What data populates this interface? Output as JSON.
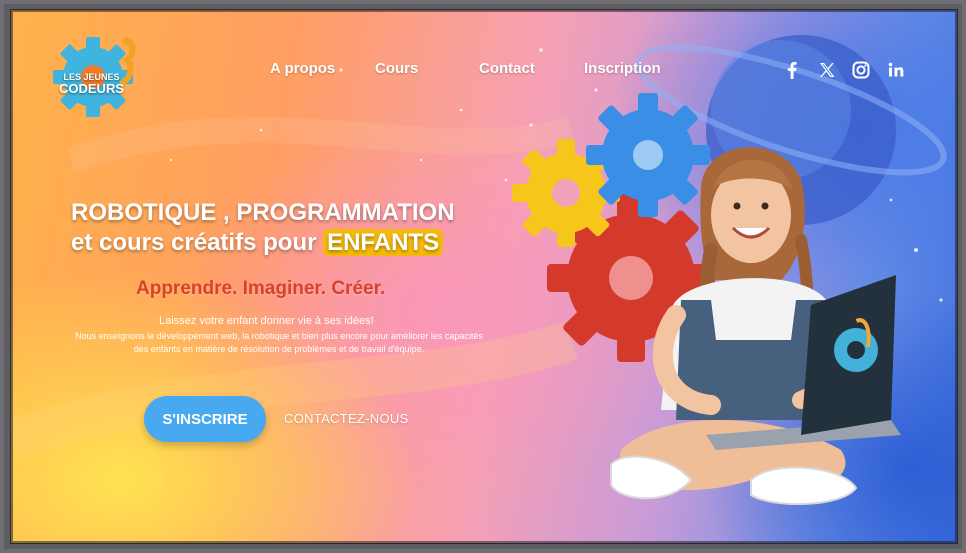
{
  "brand": {
    "line1": "LES JEUNES",
    "line2": "CODEURS"
  },
  "nav": {
    "items": [
      "A propos",
      "Cours",
      "Contact",
      "Inscription"
    ]
  },
  "social": [
    "facebook-icon",
    "x-icon",
    "instagram-icon",
    "linkedin-icon"
  ],
  "hero": {
    "headline_line1": "ROBOTIQUE , PROGRAMMATION",
    "headline_line2_prefix": "et cours créatifs pour ",
    "headline_highlight": "ENFANTS",
    "tagline": "Apprendre. Imaginer. Créer.",
    "subheadline": "Laissez votre enfant donner vie à ses idées!",
    "description": "Nous enseignons le développement web, la robotique et bien plus encore pour améliorer les capacités des enfants en matière de résolution de problèmes et de travail d'équipe.",
    "cta_primary": "S'INSCRIRE",
    "cta_secondary": "CONTACTEZ-NOUS"
  },
  "colors": {
    "accent_blue": "#49a9f0",
    "highlight_yellow": "#f5b90c",
    "tagline_red": "#d7422c"
  }
}
